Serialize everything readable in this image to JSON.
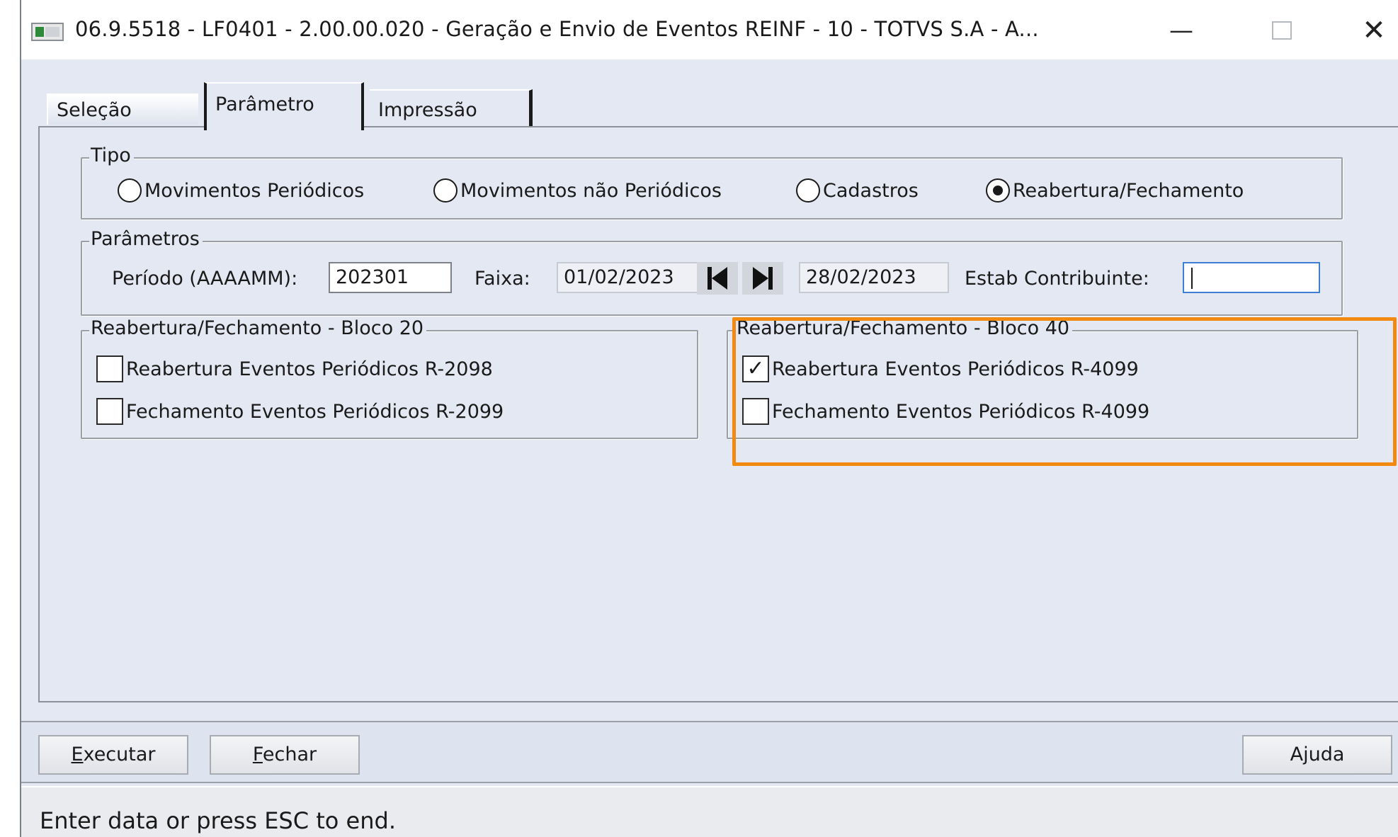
{
  "window": {
    "title": "06.9.5518 - LF0401 - 2.00.00.020 - Geração e Envio de Eventos REINF - 10 - TOTVS S.A - A...",
    "minimize": "—",
    "close": "✕"
  },
  "tabs": [
    "Seleção",
    "Parâmetro",
    "Impressão"
  ],
  "tipo": {
    "label": "Tipo",
    "options": [
      "Movimentos Periódicos",
      "Movimentos não Periódicos",
      "Cadastros",
      "Reabertura/Fechamento"
    ],
    "selected": "Reabertura/Fechamento"
  },
  "parametros": {
    "label": "Parâmetros",
    "periodo_label": "Período (AAAAMM):",
    "periodo_value": "202301",
    "faixa_label": "Faixa:",
    "faixa_start": "01/02/2023",
    "faixa_end": "28/02/2023",
    "estab_label": "Estab Contribuinte:",
    "estab_value": ""
  },
  "bloco20": {
    "label": "Reabertura/Fechamento - Bloco 20",
    "items": [
      {
        "label": "Reabertura Eventos Periódicos R-2098",
        "checked": false
      },
      {
        "label": "Fechamento Eventos Periódicos R-2099",
        "checked": false
      }
    ]
  },
  "bloco40": {
    "label": "Reabertura/Fechamento - Bloco 40",
    "items": [
      {
        "label": "Reabertura Eventos Periódicos R-4099",
        "checked": true
      },
      {
        "label": "Fechamento Eventos Periódicos R-4099",
        "checked": false
      }
    ]
  },
  "buttons": {
    "executar": {
      "mnemonic": "E",
      "rest": "xecutar"
    },
    "fechar": {
      "mnemonic": "F",
      "rest": "echar"
    },
    "ajuda": {
      "pre": "A",
      "mnemonic": "j",
      "rest": "uda"
    }
  },
  "status": "Enter data or press ESC to end.",
  "colors": {
    "highlight": "#f28a11",
    "window_bg": "#e4e8f2"
  }
}
